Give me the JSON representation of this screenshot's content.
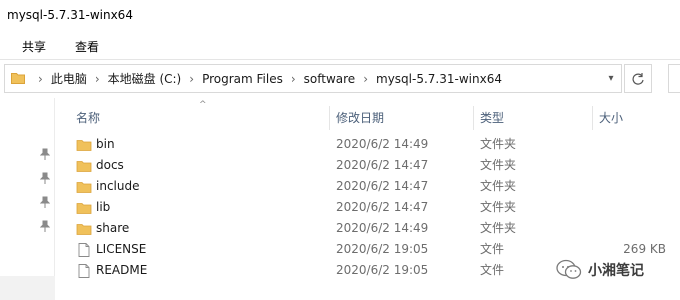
{
  "window": {
    "title": "mysql-5.7.31-winx64"
  },
  "ribbon": {
    "tabs": [
      "共享",
      "查看"
    ]
  },
  "address": {
    "crumbs": [
      "此电脑",
      "本地磁盘 (C:)",
      "Program Files",
      "software",
      "mysql-5.7.31-winx64"
    ]
  },
  "columns": {
    "name": "名称",
    "date": "修改日期",
    "type": "类型",
    "size": "大小"
  },
  "files": [
    {
      "name": "bin",
      "date": "2020/6/2 14:49",
      "type": "文件夹",
      "size": "",
      "icon": "folder-icon"
    },
    {
      "name": "docs",
      "date": "2020/6/2 14:47",
      "type": "文件夹",
      "size": "",
      "icon": "folder-icon"
    },
    {
      "name": "include",
      "date": "2020/6/2 14:47",
      "type": "文件夹",
      "size": "",
      "icon": "folder-icon"
    },
    {
      "name": "lib",
      "date": "2020/6/2 14:47",
      "type": "文件夹",
      "size": "",
      "icon": "folder-icon"
    },
    {
      "name": "share",
      "date": "2020/6/2 14:49",
      "type": "文件夹",
      "size": "",
      "icon": "folder-icon"
    },
    {
      "name": "LICENSE",
      "date": "2020/6/2 19:05",
      "type": "文件",
      "size": "269 KB",
      "icon": "file-icon"
    },
    {
      "name": "README",
      "date": "2020/6/2 19:05",
      "type": "文件",
      "size": "",
      "icon": "file-icon"
    }
  ],
  "watermark": {
    "text": "小湘笔记"
  },
  "colors": {
    "folder": "#f0c15b",
    "folder_dark": "#dba33a",
    "header_text": "#4c607a"
  }
}
